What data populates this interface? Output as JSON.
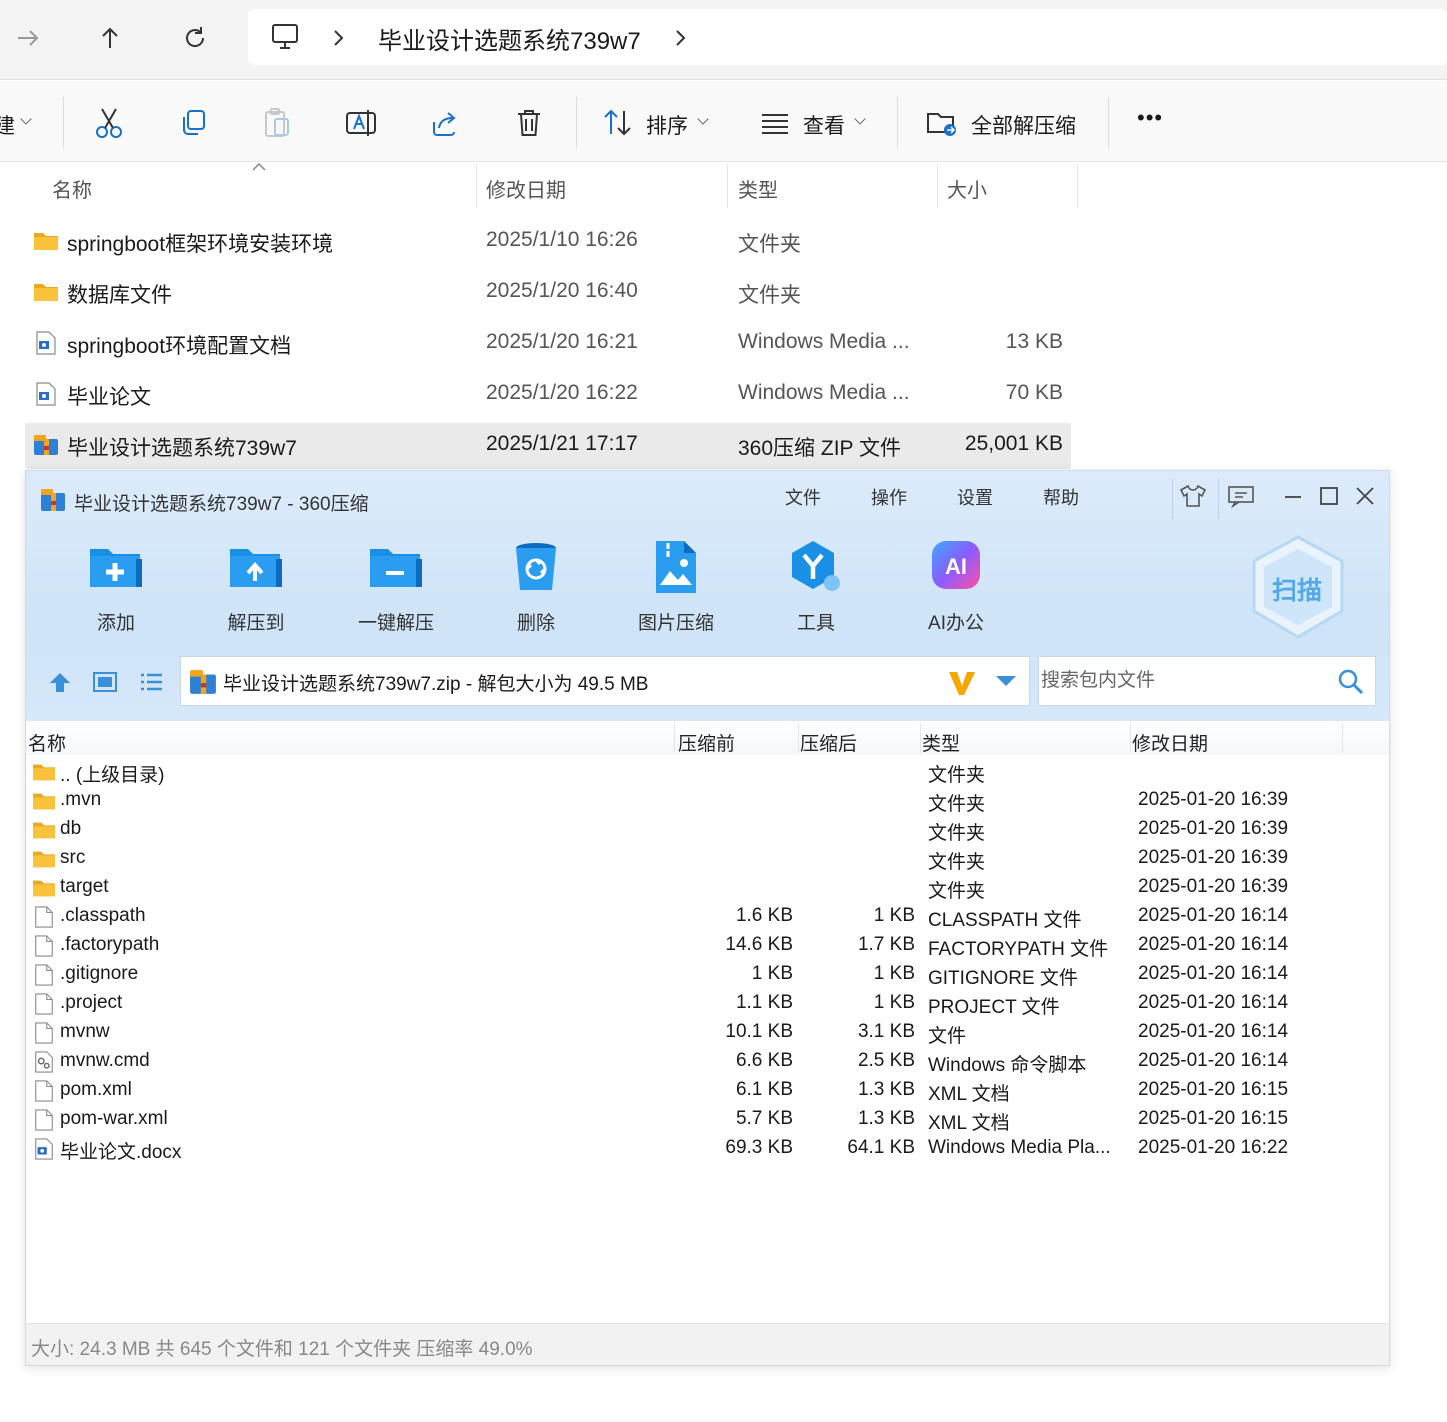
{
  "address": {
    "breadcrumb_title": "毕业设计选题系统739w7"
  },
  "toolbar": {
    "new_label_partial": "建",
    "sort_label": "排序",
    "view_label": "查看",
    "extract_all_label": "全部解压缩",
    "more_label": "•••"
  },
  "explorer_headers": {
    "name": "名称",
    "date": "修改日期",
    "type": "类型",
    "size": "大小"
  },
  "explorer_rows": [
    {
      "name": "springboot框架环境安装环境",
      "date": "2025/1/10 16:26",
      "type": "文件夹",
      "size": "",
      "icon": "folder-icon"
    },
    {
      "name": "数据库文件",
      "date": "2025/1/20 16:40",
      "type": "文件夹",
      "size": "",
      "icon": "folder-icon"
    },
    {
      "name": "springboot环境配置文档",
      "date": "2025/1/20 16:21",
      "type": "Windows Media ...",
      "size": "13 KB",
      "icon": "document-icon"
    },
    {
      "name": "毕业论文",
      "date": "2025/1/20 16:22",
      "type": "Windows Media ...",
      "size": "70 KB",
      "icon": "document-icon"
    },
    {
      "name": "毕业设计选题系统739w7",
      "date": "2025/1/21 17:17",
      "type": "360压缩 ZIP 文件",
      "size": "25,001 KB",
      "icon": "zip-archive-icon"
    }
  ],
  "zip_window": {
    "title": "毕业设计选题系统739w7 - 360压缩",
    "menu": [
      "文件",
      "操作",
      "设置",
      "帮助"
    ],
    "tools": [
      "添加",
      "解压到",
      "一键解压",
      "删除",
      "图片压缩",
      "工具",
      "AI办公"
    ],
    "ai_badge": "AI",
    "scan_label": "扫描",
    "path_text": "毕业设计选题系统739w7.zip - 解包大小为 49.5 MB",
    "search_placeholder": "搜索包内文件",
    "headers": {
      "name": "名称",
      "before": "压缩前",
      "after": "压缩后",
      "type": "类型",
      "date": "修改日期"
    },
    "rows": [
      {
        "name": ".. (上级目录)",
        "before": "",
        "after": "",
        "type": "文件夹",
        "date": "",
        "icon": "folder-icon"
      },
      {
        "name": ".mvn",
        "before": "",
        "after": "",
        "type": "文件夹",
        "date": "2025-01-20 16:39",
        "icon": "folder-icon"
      },
      {
        "name": "db",
        "before": "",
        "after": "",
        "type": "文件夹",
        "date": "2025-01-20 16:39",
        "icon": "folder-icon"
      },
      {
        "name": "src",
        "before": "",
        "after": "",
        "type": "文件夹",
        "date": "2025-01-20 16:39",
        "icon": "folder-icon"
      },
      {
        "name": "target",
        "before": "",
        "after": "",
        "type": "文件夹",
        "date": "2025-01-20 16:39",
        "icon": "folder-icon"
      },
      {
        "name": ".classpath",
        "before": "1.6 KB",
        "after": "1 KB",
        "type": "CLASSPATH 文件",
        "date": "2025-01-20 16:14",
        "icon": "file-icon"
      },
      {
        "name": ".factorypath",
        "before": "14.6 KB",
        "after": "1.7 KB",
        "type": "FACTORYPATH 文件",
        "date": "2025-01-20 16:14",
        "icon": "file-icon"
      },
      {
        "name": ".gitignore",
        "before": "1 KB",
        "after": "1 KB",
        "type": "GITIGNORE 文件",
        "date": "2025-01-20 16:14",
        "icon": "file-icon"
      },
      {
        "name": ".project",
        "before": "1.1 KB",
        "after": "1 KB",
        "type": "PROJECT 文件",
        "date": "2025-01-20 16:14",
        "icon": "file-icon"
      },
      {
        "name": "mvnw",
        "before": "10.1 KB",
        "after": "3.1 KB",
        "type": "文件",
        "date": "2025-01-20 16:14",
        "icon": "file-icon"
      },
      {
        "name": "mvnw.cmd",
        "before": "6.6 KB",
        "after": "2.5 KB",
        "type": "Windows 命令脚本",
        "date": "2025-01-20 16:14",
        "icon": "script-icon"
      },
      {
        "name": "pom.xml",
        "before": "6.1 KB",
        "after": "1.3 KB",
        "type": "XML 文档",
        "date": "2025-01-20 16:15",
        "icon": "file-icon"
      },
      {
        "name": "pom-war.xml",
        "before": "5.7 KB",
        "after": "1.3 KB",
        "type": "XML 文档",
        "date": "2025-01-20 16:15",
        "icon": "file-icon"
      },
      {
        "name": "毕业论文.docx",
        "before": "69.3 KB",
        "after": "64.1 KB",
        "type": "Windows Media Pla...",
        "date": "2025-01-20 16:22",
        "icon": "document-icon"
      }
    ],
    "status": "大小: 24.3 MB 共 645 个文件和 121 个文件夹 压缩率 49.0%"
  },
  "colors": {
    "accent_blue": "#1a8fe6",
    "folder_yellow": "#f8c33a",
    "selected_row": "#eaeaea"
  }
}
